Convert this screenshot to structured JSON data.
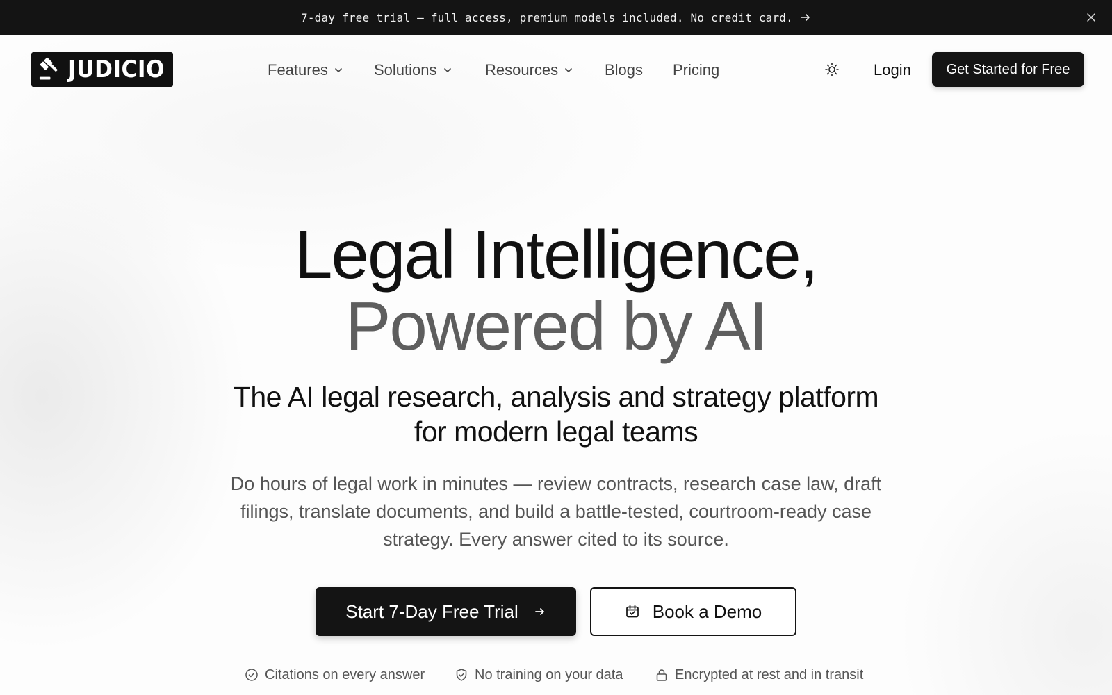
{
  "announcement": {
    "text": "7-day free trial — full access, premium models included. No credit card.",
    "arrow_icon": "arrow-right-icon",
    "close_icon": "close-icon"
  },
  "brand": {
    "name": "JUDICIO",
    "logo_icon": "gavel-icon"
  },
  "nav": {
    "items": [
      {
        "label": "Features",
        "has_dropdown": true
      },
      {
        "label": "Solutions",
        "has_dropdown": true
      },
      {
        "label": "Resources",
        "has_dropdown": true
      },
      {
        "label": "Blogs",
        "has_dropdown": false
      },
      {
        "label": "Pricing",
        "has_dropdown": false
      }
    ],
    "theme_icon": "sun-icon",
    "login_label": "Login",
    "cta_label": "Get Started for Free"
  },
  "hero": {
    "title_line1": "Legal Intelligence,",
    "title_line2": "Powered by AI",
    "subhead_line1": "The AI legal research, analysis and strategy platform",
    "subhead_line2": "for modern legal teams",
    "description": "Do hours of legal work in minutes — review contracts, research case law, draft filings, translate documents, and build a battle-tested, courtroom-ready case strategy. Every answer cited to its source.",
    "primary_cta": "Start 7-Day Free Trial",
    "secondary_cta": "Book a Demo",
    "trust_items": [
      {
        "label": "Citations on every answer",
        "icon": "check-circle-icon"
      },
      {
        "label": "No training on your data",
        "icon": "shield-check-icon"
      },
      {
        "label": "Encrypted at rest and in transit",
        "icon": "lock-icon"
      }
    ]
  },
  "colors": {
    "primary_dark": "#141414",
    "title_secondary": "#5e5e5e",
    "body_text": "#555555"
  }
}
